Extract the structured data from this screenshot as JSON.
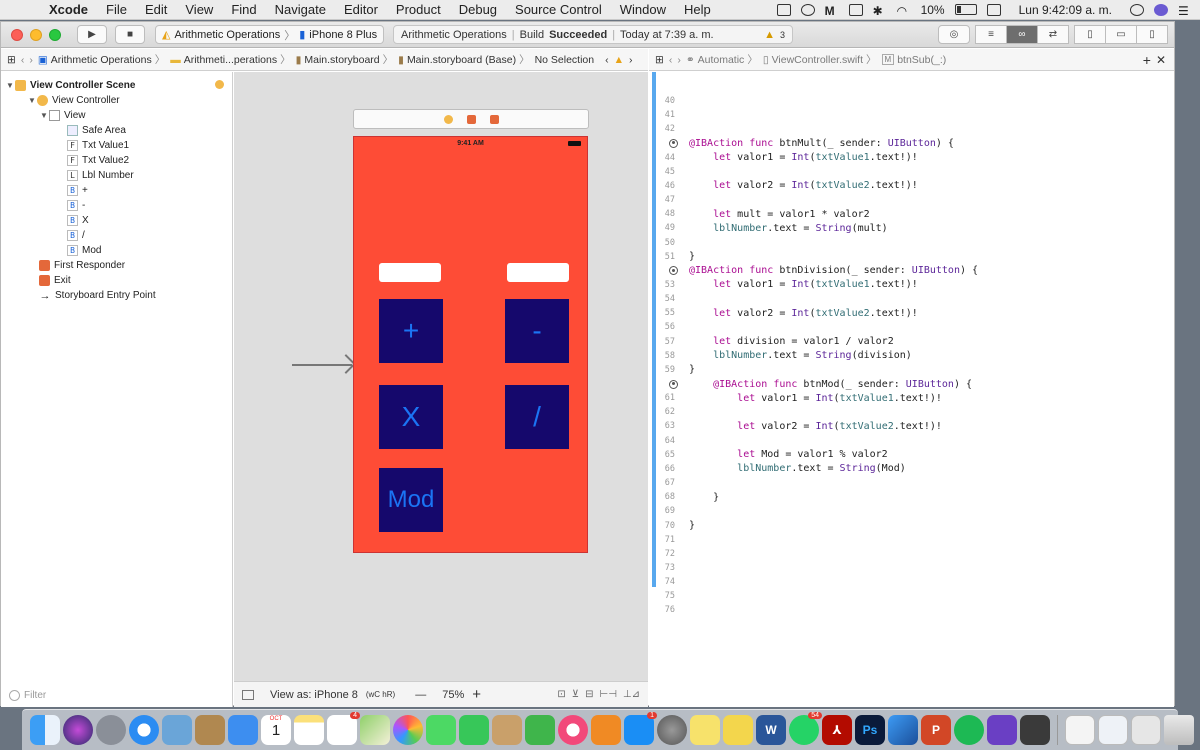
{
  "menubar": {
    "app": "Xcode",
    "items": [
      "File",
      "Edit",
      "View",
      "Find",
      "Navigate",
      "Editor",
      "Product",
      "Debug",
      "Source Control",
      "Window",
      "Help"
    ],
    "battery": "10%",
    "clock": "Lun 9:42:09 a. m."
  },
  "toolbar": {
    "scheme": "Arithmetic Operations",
    "device": "iPhone 8 Plus",
    "activity_project": "Arithmetic Operations",
    "activity_build": "Build",
    "activity_status": "Succeeded",
    "activity_time": "Today at 7:39 a. m.",
    "warning_count": "3"
  },
  "jumpbar_left": {
    "items": [
      "Arithmetic Operations",
      "Arithmeti...perations",
      "Main.storyboard",
      "Main.storyboard (Base)",
      "No Selection"
    ]
  },
  "jumpbar_right": {
    "mode": "Automatic",
    "file": "ViewController.swift",
    "method": "btnSub(_:)"
  },
  "outline": {
    "scene": "View Controller Scene",
    "view_controller": "View Controller",
    "view": "View",
    "children": [
      {
        "letter": "",
        "label": "Safe Area"
      },
      {
        "letter": "F",
        "label": "Txt Value1"
      },
      {
        "letter": "F",
        "label": "Txt Value2"
      },
      {
        "letter": "L",
        "label": "Lbl Number"
      },
      {
        "letter": "B",
        "label": "+"
      },
      {
        "letter": "B",
        "label": "-"
      },
      {
        "letter": "B",
        "label": "X"
      },
      {
        "letter": "B",
        "label": "/"
      },
      {
        "letter": "B",
        "label": "Mod"
      }
    ],
    "first_responder": "First Responder",
    "exit": "Exit",
    "entry": "Storyboard Entry Point",
    "filter_placeholder": "Filter"
  },
  "canvas": {
    "status_time": "9:41 AM",
    "buttons": [
      "+",
      "-",
      "X",
      "/",
      "Mod"
    ],
    "view_as": "View as: iPhone 8",
    "view_as_size": "(wC hR)",
    "zoom": "75%"
  },
  "code": {
    "lines": [
      {
        "n": "40",
        "text": ""
      },
      {
        "n": "41",
        "text": ""
      },
      {
        "n": "42",
        "text": ""
      },
      {
        "n": "",
        "bp": true,
        "text": "@IBAction func btnMult(_ sender: UIButton) {"
      },
      {
        "n": "44",
        "text": "    let valor1 = Int(txtValue1.text!)!"
      },
      {
        "n": "45",
        "text": ""
      },
      {
        "n": "46",
        "text": "    let valor2 = Int(txtValue2.text!)!"
      },
      {
        "n": "47",
        "text": ""
      },
      {
        "n": "48",
        "text": "    let mult = valor1 * valor2"
      },
      {
        "n": "49",
        "text": "    lblNumber.text = String(mult)"
      },
      {
        "n": "50",
        "text": ""
      },
      {
        "n": "51",
        "text": "}"
      },
      {
        "n": "",
        "bp": true,
        "text": "@IBAction func btnDivision(_ sender: UIButton) {"
      },
      {
        "n": "53",
        "text": "    let valor1 = Int(txtValue1.text!)!"
      },
      {
        "n": "54",
        "text": ""
      },
      {
        "n": "55",
        "text": "    let valor2 = Int(txtValue2.text!)!"
      },
      {
        "n": "56",
        "text": ""
      },
      {
        "n": "57",
        "text": "    let division = valor1 / valor2"
      },
      {
        "n": "58",
        "text": "    lblNumber.text = String(division)"
      },
      {
        "n": "59",
        "text": "}"
      },
      {
        "n": "",
        "bp": true,
        "text": "    @IBAction func btnMod(_ sender: UIButton) {"
      },
      {
        "n": "61",
        "text": "        let valor1 = Int(txtValue1.text!)!"
      },
      {
        "n": "62",
        "text": ""
      },
      {
        "n": "63",
        "text": "        let valor2 = Int(txtValue2.text!)!"
      },
      {
        "n": "64",
        "text": ""
      },
      {
        "n": "65",
        "text": "        let Mod = valor1 % valor2"
      },
      {
        "n": "66",
        "text": "        lblNumber.text = String(Mod)"
      },
      {
        "n": "67",
        "text": ""
      },
      {
        "n": "68",
        "text": "    }"
      },
      {
        "n": "69",
        "text": ""
      },
      {
        "n": "70",
        "text": "}"
      },
      {
        "n": "71",
        "text": ""
      },
      {
        "n": "72",
        "text": ""
      },
      {
        "n": "73",
        "text": ""
      },
      {
        "n": "74",
        "text": ""
      },
      {
        "n": "75",
        "text": ""
      },
      {
        "n": "76",
        "text": ""
      }
    ]
  },
  "dock": {
    "calendar_month": "OCT",
    "calendar_day": "1",
    "reminders_badge": "4",
    "appstore_badge": "1",
    "whatsapp_badge": "54",
    "photoshop": "Ps",
    "word": "W",
    "powerpoint": "P"
  },
  "colors": {
    "phone_background": "#fe4c36",
    "button_background": "#15086c",
    "button_text": "#1b74f4",
    "accent_gutter": "#58a8ee"
  }
}
